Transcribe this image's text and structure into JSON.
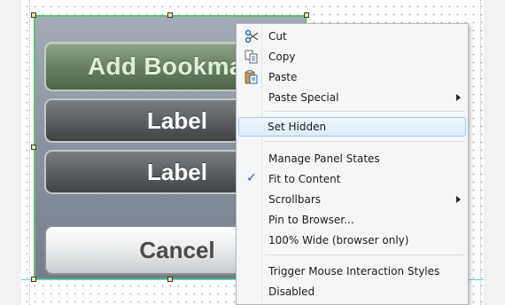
{
  "dialog": {
    "buttons": {
      "bookmark": "Add Bookmark",
      "label1": "Label",
      "label2": "Label",
      "cancel": "Cancel"
    }
  },
  "context_menu": {
    "items": [
      {
        "label": "Cut",
        "icon": "scissors-icon"
      },
      {
        "label": "Copy",
        "icon": "copy-icon"
      },
      {
        "label": "Paste",
        "icon": "paste-icon"
      },
      {
        "label": "Paste Special",
        "submenu": true
      },
      {
        "label": "Set Hidden",
        "highlighted": true
      },
      {
        "label": "Manage Panel States"
      },
      {
        "label": "Fit to Content",
        "checked": true
      },
      {
        "label": "Scrollbars",
        "submenu": true
      },
      {
        "label": "Pin to Browser..."
      },
      {
        "label": "100% Wide (browser only)"
      },
      {
        "label": "Trigger Mouse Interaction Styles"
      },
      {
        "label": "Disabled"
      }
    ]
  },
  "colors": {
    "selection_border": "#5cc16b",
    "guide_line": "#5fd6e0",
    "menu_highlight": "#dcebfc",
    "check_mark": "#2c5aa0"
  }
}
